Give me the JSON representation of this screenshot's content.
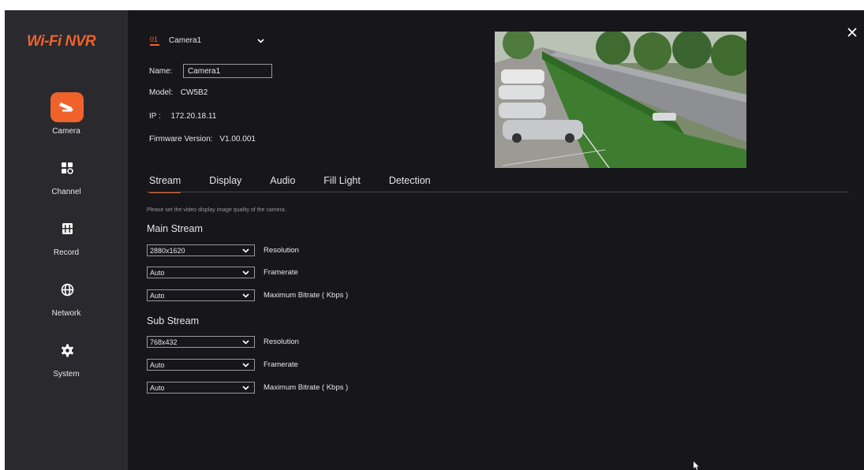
{
  "brand": {
    "logo": "Wi-Fi NVR",
    "accent": "#f0622a"
  },
  "sidebar": {
    "items": [
      {
        "label": "Camera",
        "icon": "camera-icon",
        "active": true
      },
      {
        "label": "Channel",
        "icon": "channel-grid-icon",
        "active": false
      },
      {
        "label": "Record",
        "icon": "record-film-icon",
        "active": false
      },
      {
        "label": "Network",
        "icon": "globe-icon",
        "active": false
      },
      {
        "label": "System",
        "icon": "gear-icon",
        "active": false
      }
    ]
  },
  "camera": {
    "number": "01",
    "selected": "Camera1",
    "name_label": "Name:",
    "name_value": "Camera1",
    "model_label": "Model:",
    "model_value": "CW5B2",
    "ip_label": "IP :",
    "ip_value": "172.20.18.11",
    "firmware_label": "Firmware Version:",
    "firmware_value": "V1.00.001"
  },
  "tabs": [
    "Stream",
    "Display",
    "Audio",
    "Fill Light",
    "Detection"
  ],
  "active_tab": "Stream",
  "stream": {
    "hint": "Please set the video display image quality of the camera.",
    "main": {
      "title": "Main Stream",
      "fields": [
        {
          "value": "2880x1620",
          "label": "Resolution"
        },
        {
          "value": "Auto",
          "label": "Framerate"
        },
        {
          "value": "Auto",
          "label": "Maximum Bitrate ( Kbps )"
        }
      ]
    },
    "sub": {
      "title": "Sub Stream",
      "fields": [
        {
          "value": "768x432",
          "label": "Resolution"
        },
        {
          "value": "Auto",
          "label": "Framerate"
        },
        {
          "value": "Auto",
          "label": "Maximum Bitrate ( Kbps )"
        }
      ]
    }
  }
}
